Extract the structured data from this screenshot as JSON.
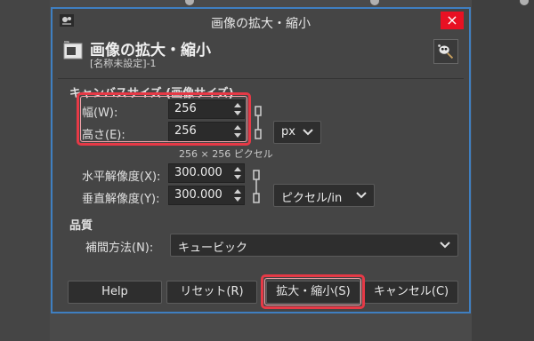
{
  "window": {
    "title": "画像の拡大・縮小",
    "close_glyph": "×"
  },
  "header": {
    "title": "画像の拡大・縮小",
    "subtitle": "[名称未設定]-1"
  },
  "canvas_section": {
    "title": "キャンバスサイズ (画像サイズ)",
    "width_label": "幅(W):",
    "width_value": "256",
    "height_label": "高さ(E):",
    "height_value": "256",
    "unit": "px",
    "size_info": "256 × 256 ピクセル"
  },
  "resolution": {
    "x_label": "水平解像度(X):",
    "x_value": "300.000",
    "y_label": "垂直解像度(Y):",
    "y_value": "300.000",
    "unit": "ピクセル/in"
  },
  "quality_section": {
    "title": "品質",
    "interp_label": "補間方法(N):",
    "interp_value": "キュービック"
  },
  "buttons": {
    "help": "Help",
    "reset": "リセット(R)",
    "scale": "拡大・縮小(S)",
    "cancel": "キャンセル(C)"
  },
  "colors": {
    "accent_border": "#3f7fc1",
    "highlight": "#e63946",
    "close": "#e81123"
  },
  "icons": {
    "window": "gimp-wilber-icon",
    "header": "scale-image-icon",
    "tool": "gimp-tool-icon",
    "chain": "chain-link-icon"
  }
}
